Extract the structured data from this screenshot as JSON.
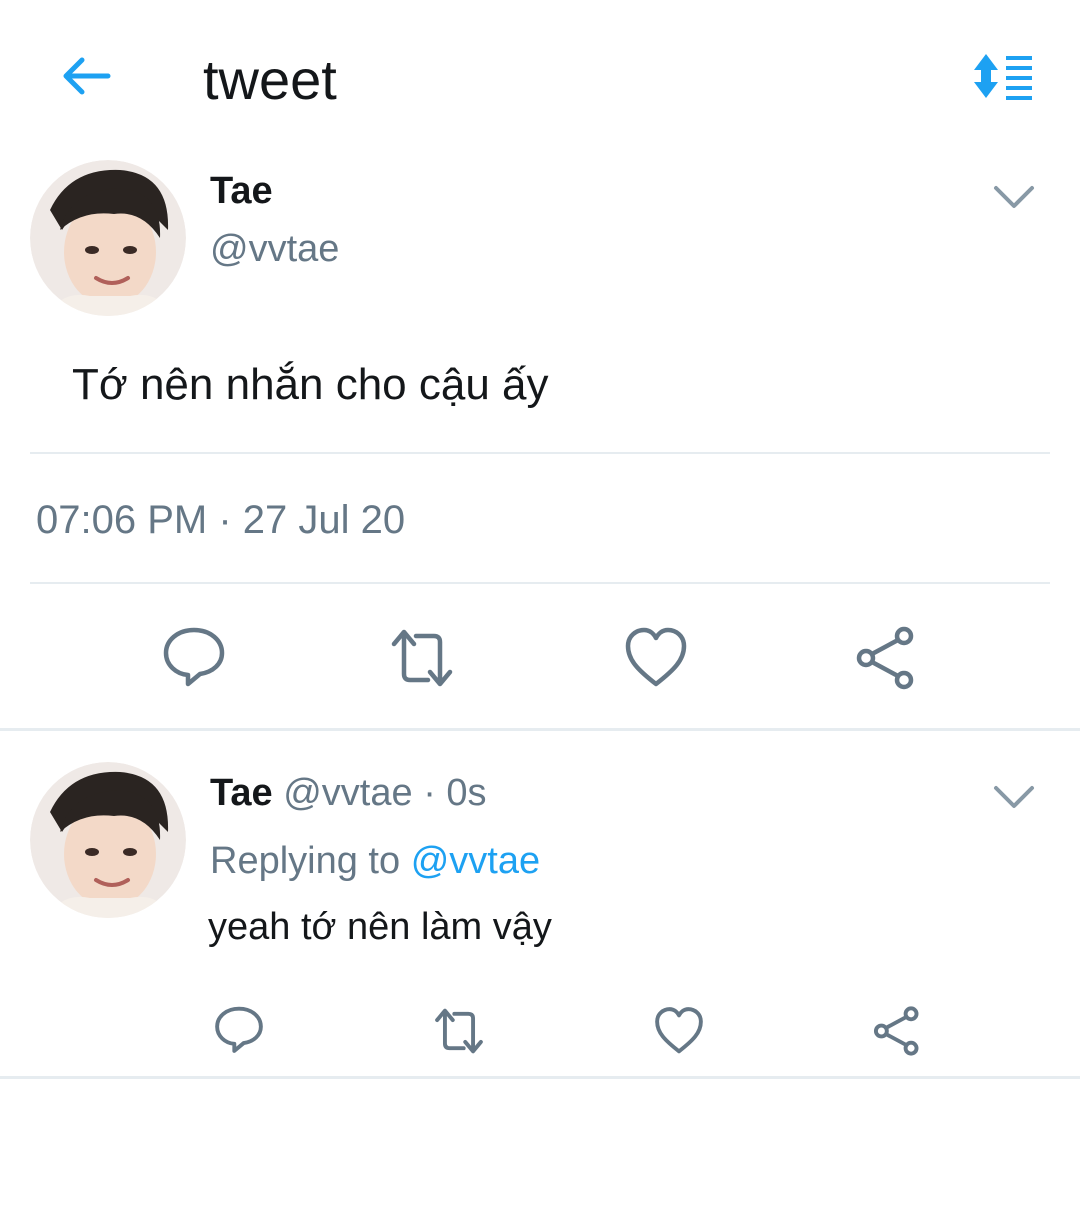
{
  "header": {
    "title": "tweet",
    "back_icon": "arrow-left-icon",
    "sort_icon": "sort-lines-icon"
  },
  "colors": {
    "accent": "#1da1f2",
    "secondary_text": "#657786",
    "primary_text": "#14171a",
    "icon_gray": "#657786"
  },
  "main_tweet": {
    "name": "Tae",
    "handle": "@vvtae",
    "text": "Tớ nên nhắn cho cậu ấy",
    "timestamp": "07:06 PM · 27 Jul 20",
    "actions": [
      "reply-icon",
      "retweet-icon",
      "like-icon",
      "share-icon"
    ]
  },
  "reply_tweet": {
    "name": "Tae",
    "handle": "@vvtae",
    "time": "· 0s",
    "replying_label": "Replying to",
    "replying_to": "@vvtae",
    "text": "yeah tớ nên làm vậy",
    "actions": [
      "reply-icon",
      "retweet-icon",
      "like-icon",
      "share-icon"
    ]
  }
}
